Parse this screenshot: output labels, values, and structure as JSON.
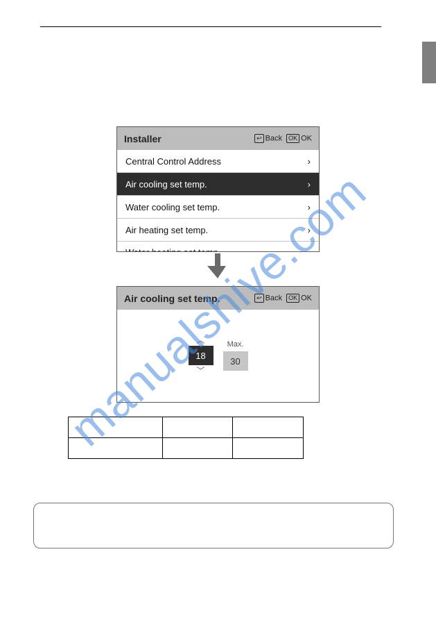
{
  "watermark": "manualshive.com",
  "panel1": {
    "title": "Installer",
    "back_icon": "↩",
    "back_label": "Back",
    "ok_icon": "OK",
    "ok_label": "OK",
    "items": [
      {
        "label": "Central Control Address",
        "selected": false
      },
      {
        "label": "Air cooling set temp.",
        "selected": true
      },
      {
        "label": "Water cooling set temp.",
        "selected": false
      },
      {
        "label": "Air heating set temp.",
        "selected": false
      },
      {
        "label": "Water heating set temp.",
        "selected": false
      }
    ]
  },
  "panel2": {
    "title": "Air cooling set temp.",
    "back_icon": "↩",
    "back_label": "Back",
    "ok_icon": "OK",
    "ok_label": "OK",
    "min_value": "18",
    "max_label": "Max.",
    "max_value": "30"
  }
}
